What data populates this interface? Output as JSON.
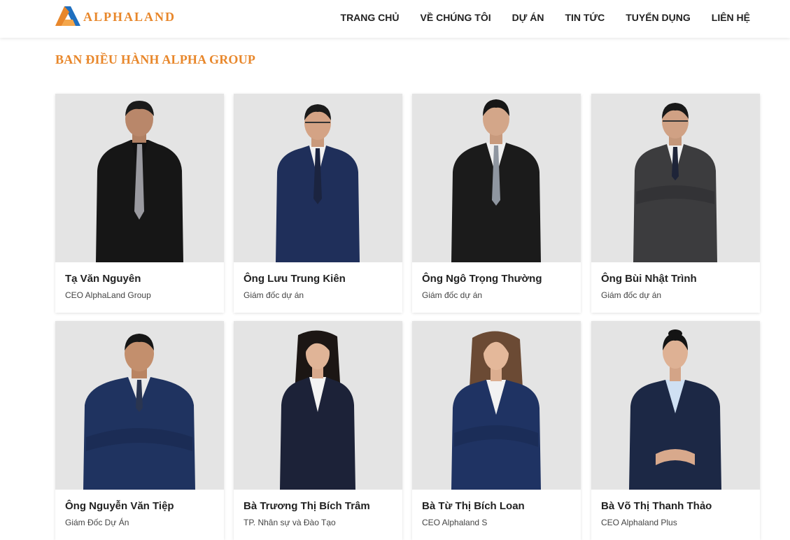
{
  "brand": {
    "name": "ALPHALAND",
    "accent": "#e8872b",
    "blue": "#1f6fbf"
  },
  "nav": [
    {
      "label": "TRANG CHỦ"
    },
    {
      "label": "VỀ CHÚNG TÔI"
    },
    {
      "label": "DỰ ÁN"
    },
    {
      "label": "TIN TỨC"
    },
    {
      "label": "TUYỂN DỤNG"
    },
    {
      "label": "LIÊN HỆ"
    }
  ],
  "section": {
    "title": "BAN ĐIỀU HÀNH ALPHA GROUP"
  },
  "members": [
    {
      "name": "Tạ Văn Nguyên",
      "role": "CEO AlphaLand Group",
      "photo": "man-black-suit-portrait"
    },
    {
      "name": "Ông Lưu Trung Kiên",
      "role": "Giám đốc dự án",
      "photo": "man-navy-suit-portrait"
    },
    {
      "name": "Ông Ngô Trọng Thường",
      "role": "Giám đốc dự án",
      "photo": "man-black-suit-portrait"
    },
    {
      "name": "Ông Bùi Nhật Trình",
      "role": "Giám đốc dự án",
      "photo": "man-grey-suit-arms-crossed-portrait"
    },
    {
      "name": "Ông Nguyễn Văn Tiệp",
      "role": "Giám Đốc Dự Án",
      "photo": "man-navy-suit-arms-crossed-portrait"
    },
    {
      "name": "Bà Trương Thị Bích Trâm",
      "role": "TP. Nhân sự và Đào Tạo",
      "photo": "woman-navy-suit-portrait"
    },
    {
      "name": "Bà Từ Thị Bích Loan",
      "role": "CEO Alphaland S",
      "photo": "woman-navy-suit-arms-crossed-portrait"
    },
    {
      "name": "Bà Võ Thị Thanh Thảo",
      "role": "CEO Alphaland Plus",
      "photo": "woman-navy-suit-portrait"
    }
  ]
}
